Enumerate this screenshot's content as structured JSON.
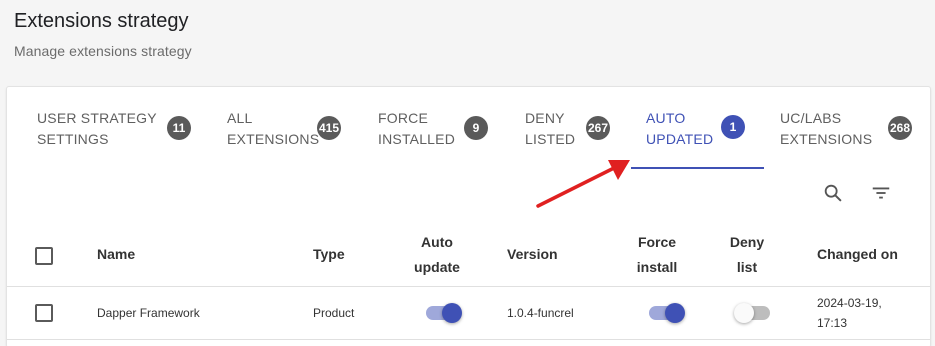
{
  "header": {
    "title": "Extensions strategy",
    "subtitle": "Manage extensions strategy"
  },
  "tabs": [
    {
      "line1": "USER STRATEGY",
      "line2": "SETTINGS",
      "count": "11",
      "active": false
    },
    {
      "line1": "ALL",
      "line2": "EXTENSIONS",
      "count": "415",
      "active": false
    },
    {
      "line1": "FORCE",
      "line2": "INSTALLED",
      "count": "9",
      "active": false
    },
    {
      "line1": "DENY",
      "line2": "LISTED",
      "count": "267",
      "active": false
    },
    {
      "line1": "AUTO",
      "line2": "UPDATED",
      "count": "1",
      "active": true
    },
    {
      "line1": "UC/LABS",
      "line2": "EXTENSIONS",
      "count": "268",
      "active": false
    }
  ],
  "toolbar": {
    "search_icon": "search-icon",
    "filter_icon": "filter-icon"
  },
  "table": {
    "columns": {
      "name": "Name",
      "type": "Type",
      "auto_update_1": "Auto",
      "auto_update_2": "update",
      "version": "Version",
      "force_install_1": "Force",
      "force_install_2": "install",
      "deny_list_1": "Deny",
      "deny_list_2": "list",
      "changed_on": "Changed on"
    },
    "rows": [
      {
        "name": "Dapper Framework",
        "type": "Product",
        "auto_update": true,
        "version": "1.0.4-funcrel",
        "force_install": true,
        "deny_list": false,
        "changed_on_date": "2024-03-19,",
        "changed_on_time": "17:13"
      }
    ]
  },
  "colors": {
    "accent": "#3f51b5",
    "annotation_arrow": "#e02020"
  }
}
